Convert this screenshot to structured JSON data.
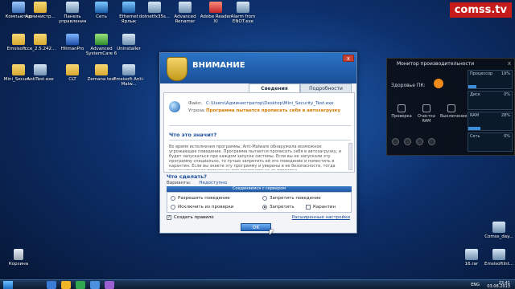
{
  "brand": "comss.tv",
  "desktop_icons": [
    {
      "label": "Компьютер",
      "icon": "pc"
    },
    {
      "label": "Администр...",
      "icon": "folder"
    },
    {
      "label": "Панель управления",
      "icon": "app"
    },
    {
      "label": "Сеть",
      "icon": "net"
    },
    {
      "label": "Ethernet Ярлык",
      "icon": "net"
    },
    {
      "label": "dotnetfx35s...",
      "icon": "app"
    },
    {
      "label": "Advanced Renamer",
      "icon": "app"
    },
    {
      "label": "Adobe Reader XI",
      "icon": "red"
    },
    {
      "label": "Alarm from ENOT.exe",
      "icon": "app"
    },
    {
      "label": "Emsisoft...",
      "icon": "folder"
    },
    {
      "label": "cce_2.5.242...",
      "icon": "folder"
    },
    {
      "label": "HitmanPro",
      "icon": "blue"
    },
    {
      "label": "Advanced SystemCare 6",
      "icon": "green"
    },
    {
      "label": "Uninstaller",
      "icon": "app"
    },
    {
      "label": "Mini_Securi...",
      "icon": "folder"
    },
    {
      "label": "AntiTest.exe",
      "icon": "app"
    },
    {
      "label": "CLT",
      "icon": "folder"
    },
    {
      "label": "Zemana test",
      "icon": "folder"
    },
    {
      "label": "Emsisoft Anti-Malw...",
      "icon": "app"
    },
    {
      "label": "Корзина",
      "icon": "bin"
    },
    {
      "label": "Comss_day...",
      "icon": "app"
    },
    {
      "label": "EmsisoftInt...",
      "icon": "app"
    },
    {
      "label": "16.rar",
      "icon": "app"
    }
  ],
  "dialog": {
    "title": "ВНИМАНИЕ",
    "close": "x",
    "tabs": [
      "Сведения",
      "Подробности"
    ],
    "file_label": "Файл:",
    "file_value": "C:\\Users\\Администратор\\Desktop\\Mini_Security_Test.exe",
    "threat_label": "Угроза:",
    "threat_value": "Программа пытается прописать себя в автозагрузку",
    "what_title": "Что это значит?",
    "description": "Во время исполнения программы, Anti-Malware обнаружила возможное угрожающее поведение. Программа пытается прописать себя в автозагрузку, и будет запускаться при каждом запуске системы. Если вы не запускали эту программу специально, то лучше запретить ей это поведение и поместить в карантин. Если вы знаете эту программу и уверены в ее безопасности, тогда разрешите такое поведение или исключите ее из проверки.",
    "todo_title": "Что сделать?",
    "variants_label": "Варианты:",
    "variants_value": "Недоступно",
    "connection": "Соединяемся с сервером",
    "options": {
      "allow": "Разрешить поведение",
      "exclude": "Исключить из проверки",
      "block_behavior": "Запретить поведение",
      "block": "Запретить",
      "quarantine": "Карантин"
    },
    "create_rule": "Создать правило",
    "advanced": "Расширенные настройки",
    "ok": "OK"
  },
  "perf": {
    "title": "Монитор производительности",
    "close": "x",
    "health_label": "Здоровье ПК:",
    "tools": [
      "Проверка",
      "Очистка RAM",
      "Выключение"
    ],
    "meters": [
      {
        "label": "Процессор",
        "pct": "19%",
        "value": 0.19
      },
      {
        "label": "Диск",
        "pct": "0%",
        "value": 0.0
      },
      {
        "label": "RAM",
        "pct": "28%",
        "value": 0.28
      },
      {
        "label": "Сеть",
        "pct": "0%",
        "value": 0.0
      }
    ]
  },
  "taskbar": {
    "lang": "ENG",
    "time": "23:41",
    "date": "03.08.2013"
  }
}
